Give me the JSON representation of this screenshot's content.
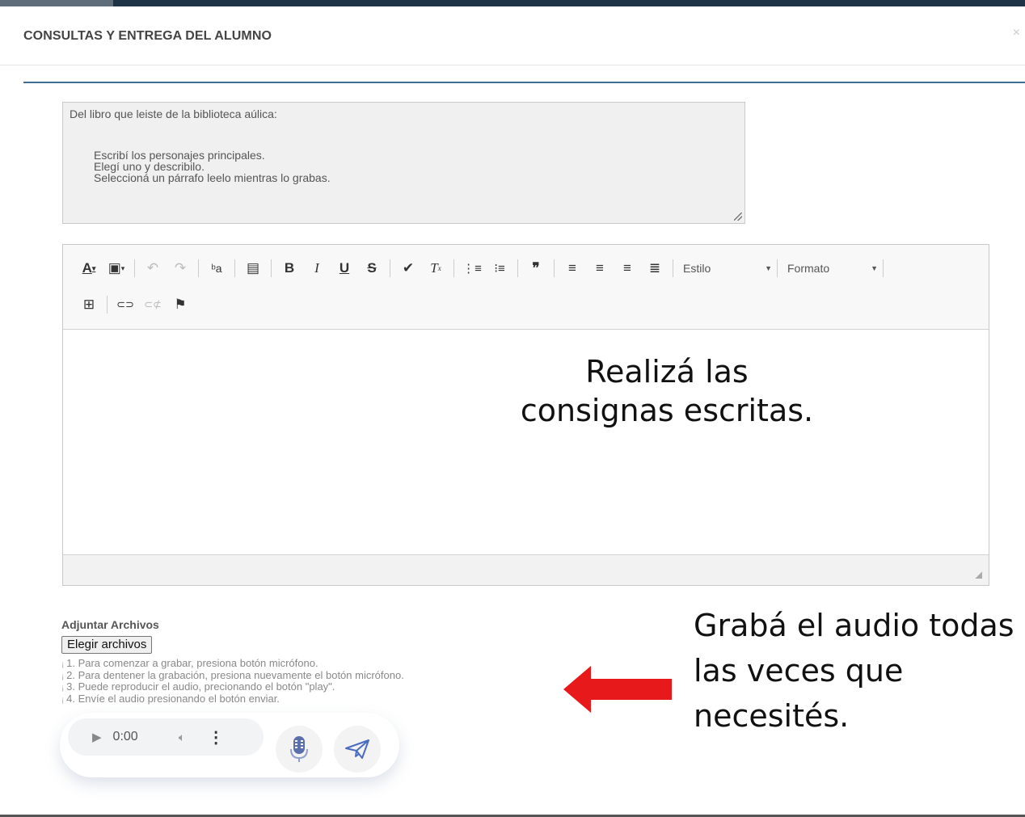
{
  "modal": {
    "title": "CONSULTAS Y ENTREGA DEL ALUMNO",
    "close_glyph": "×"
  },
  "consigna": {
    "intro": "Del libro que leiste de la biblioteca aúlica:",
    "lines": [
      "Escribí los personajes principales.",
      "Elegí uno y describilo.",
      "Seleccioná un párrafo leelo mientras lo grabas."
    ]
  },
  "toolbar": {
    "row1": [
      {
        "name": "text-color-icon",
        "glyph": "A"
      },
      {
        "name": "background-color-icon",
        "glyph": "▣"
      },
      {
        "name": "undo-icon",
        "glyph": "↶"
      },
      {
        "name": "redo-icon",
        "glyph": "↷"
      },
      {
        "name": "replace-icon",
        "glyph": "ᵇa"
      },
      {
        "name": "paste-icon",
        "glyph": "▤"
      },
      {
        "name": "bold-icon",
        "glyph": "B"
      },
      {
        "name": "italic-icon",
        "glyph": "I"
      },
      {
        "name": "underline-icon",
        "glyph": "U"
      },
      {
        "name": "strikethrough-icon",
        "glyph": "S"
      },
      {
        "name": "copy-format-icon",
        "glyph": "✔"
      },
      {
        "name": "remove-format-icon",
        "glyph": "Tx"
      },
      {
        "name": "numbered-list-icon",
        "glyph": "⋮≡"
      },
      {
        "name": "bulleted-list-icon",
        "glyph": "•≡"
      },
      {
        "name": "blockquote-icon",
        "glyph": "❞"
      },
      {
        "name": "align-left-icon",
        "glyph": "≡"
      },
      {
        "name": "align-center-icon",
        "glyph": "≡"
      },
      {
        "name": "align-right-icon",
        "glyph": "≡"
      },
      {
        "name": "align-justify-icon",
        "glyph": "≣"
      }
    ],
    "style_label": "Estilo",
    "format_label": "Formato",
    "row2": [
      {
        "name": "table-icon",
        "glyph": "⊞"
      },
      {
        "name": "link-icon",
        "glyph": "⊂⊃"
      },
      {
        "name": "unlink-icon",
        "glyph": "⊂⊄"
      },
      {
        "name": "anchor-flag-icon",
        "glyph": "⚑"
      }
    ]
  },
  "overlay": {
    "editor_note": [
      "Realizá las",
      "consignas escritas."
    ],
    "audio_note": [
      "Grabá el audio todas",
      "las veces que",
      "necesités."
    ]
  },
  "attach": {
    "label": "Adjuntar Archivos",
    "button": "Elegir archivos"
  },
  "instructions": [
    "1. Para comenzar a grabar, presiona botón micrófono.",
    "2. Para dentener la grabación, presiona nuevamente el botón micrófono.",
    "3. Puede reproducir el audio, precionando el botón \"play\".",
    "4. Envíe el audio presionando el botón enviar."
  ],
  "player": {
    "time": "0:00"
  },
  "colors": {
    "top_bar": "#1f3347",
    "divider": "#3d6f96",
    "arrow": "#e8191a",
    "mic": "#5a6fae"
  }
}
